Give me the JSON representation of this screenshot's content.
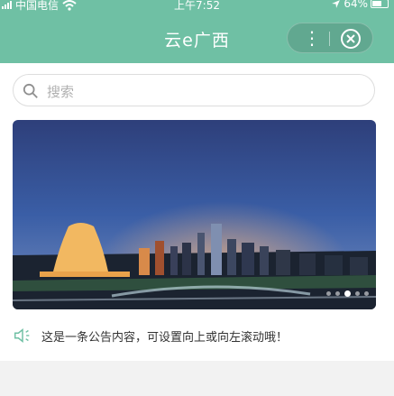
{
  "status_bar": {
    "carrier": "中国电信",
    "time": "上午7:52",
    "battery": "64%"
  },
  "nav": {
    "title": "云e广西",
    "more_icon": "more-dots-icon",
    "close_icon": "close-circle-icon"
  },
  "search": {
    "placeholder": "搜索"
  },
  "banner": {
    "dots_total": 5,
    "active_index": 2
  },
  "notice": {
    "icon": "speaker-icon",
    "text": "这是一条公告内容，可设置向上或向左滚动哦！"
  },
  "colors": {
    "accent": "#6fc0a4"
  }
}
